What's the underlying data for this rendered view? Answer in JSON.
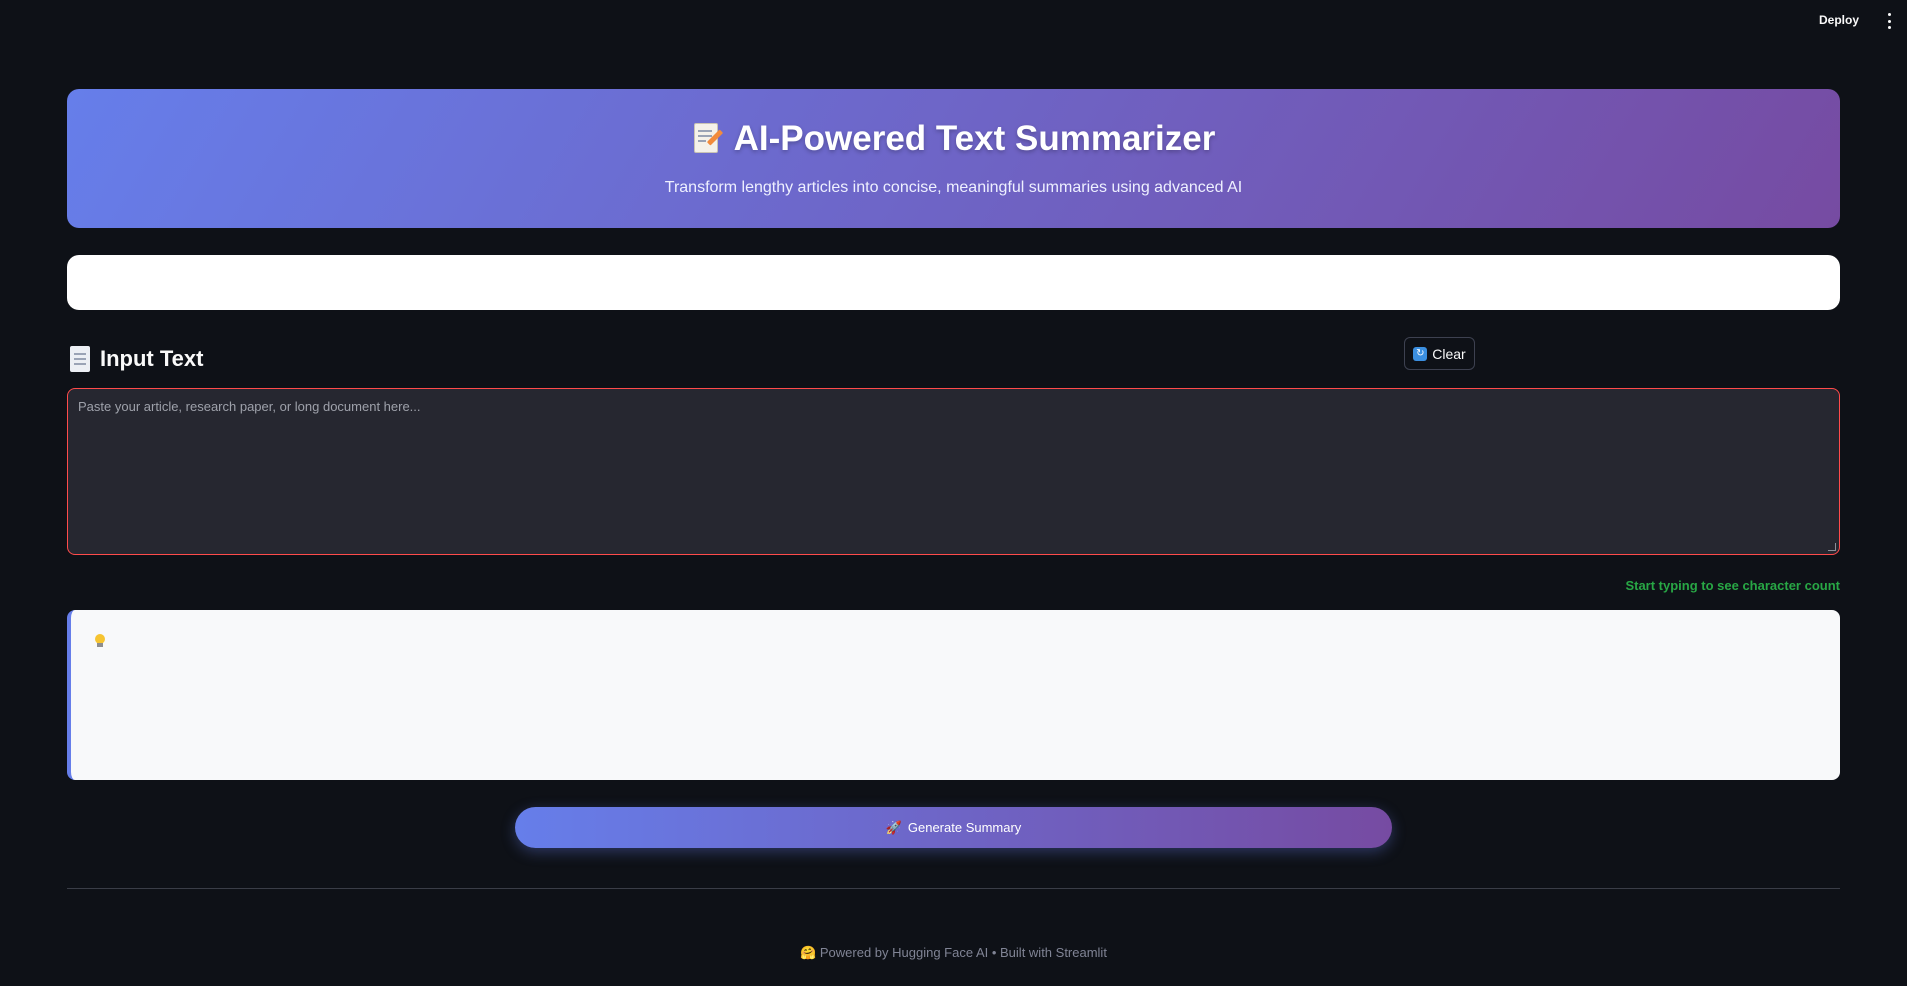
{
  "topbar": {
    "deploy_label": "Deploy",
    "menu_icon": "kebab-menu-icon"
  },
  "hero": {
    "icon": "memo-icon",
    "title": "AI-Powered Text Summarizer",
    "subtitle": "Transform lengthy articles into concise, meaningful summaries using advanced AI",
    "gradient_start": "#667eea",
    "gradient_end": "#764ba2"
  },
  "input_section": {
    "icon": "page-icon",
    "heading": "Input Text",
    "clear_label": "Clear",
    "clear_icon": "refresh-icon",
    "textarea_value": "",
    "textarea_placeholder": "Paste your article, research paper, or long document here...",
    "char_count_text": "Start typing to see character count",
    "char_count_color": "#28a745"
  },
  "tip_box": {
    "icon": "lightbulb-icon",
    "text": ""
  },
  "actions": {
    "generate_label": "Generate Summary",
    "generate_icon": "rocket-icon"
  },
  "footer": {
    "powered_by": "🤗 Powered by Hugging Face AI • Built with Streamlit"
  },
  "colors": {
    "background": "#0e1117",
    "input_border": "#ff4b4b",
    "accent": "#667eea"
  }
}
